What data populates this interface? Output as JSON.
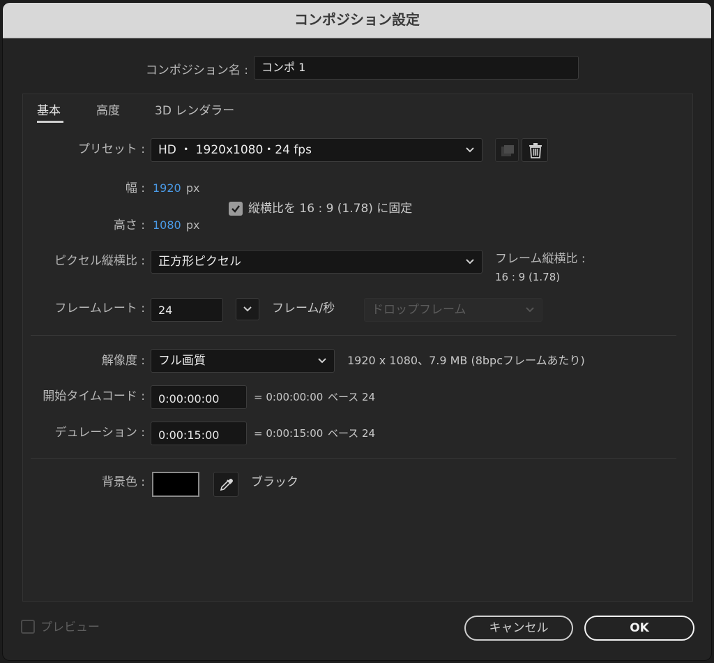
{
  "dialog": {
    "title": "コンポジション設定"
  },
  "comp_name": {
    "label": "コンポジション名 :",
    "value": "コンポ 1"
  },
  "tabs": [
    {
      "label": "基本",
      "active": true
    },
    {
      "label": "高度",
      "active": false
    },
    {
      "label": "3D レンダラー",
      "active": false
    }
  ],
  "preset": {
    "label": "プリセット :",
    "value": "HD ・ 1920x1080・24 fps"
  },
  "width": {
    "label": "幅 :",
    "value": "1920",
    "unit": "px"
  },
  "height": {
    "label": "高さ :",
    "value": "1080",
    "unit": "px"
  },
  "lock_aspect": {
    "label": "縦横比を 16 : 9 (1.78) に固定",
    "checked": true
  },
  "pixel_aspect": {
    "label": "ピクセル縦横比 :",
    "value": "正方形ピクセル"
  },
  "frame_aspect": {
    "label": "フレーム縦横比 :",
    "value": "16 : 9 (1.78)"
  },
  "frame_rate": {
    "label": "フレームレート :",
    "value": "24",
    "unit_label": "フレーム/秒",
    "drop_frame": "ドロップフレーム"
  },
  "resolution": {
    "label": "解像度 :",
    "value": "フル画質",
    "info": "1920 x 1080、7.9 MB (8bpcフレームあたり)"
  },
  "start_timecode": {
    "label": "開始タイムコード :",
    "value": "0:00:00:00",
    "equals": "= 0:00:00:00",
    "base": "ベース 24"
  },
  "duration": {
    "label": "デュレーション :",
    "value": "0:00:15:00",
    "equals": "= 0:00:15:00",
    "base": "ベース 24"
  },
  "background": {
    "label": "背景色 :",
    "color": "#000000",
    "name": "ブラック"
  },
  "footer": {
    "preview_label": "プレビュー",
    "cancel_label": "キャンセル",
    "ok_label": "OK"
  },
  "colors": {
    "accent_value": "#4a9ae6",
    "titlebar": "#d8d8d8",
    "dialog_bg": "#232323"
  }
}
